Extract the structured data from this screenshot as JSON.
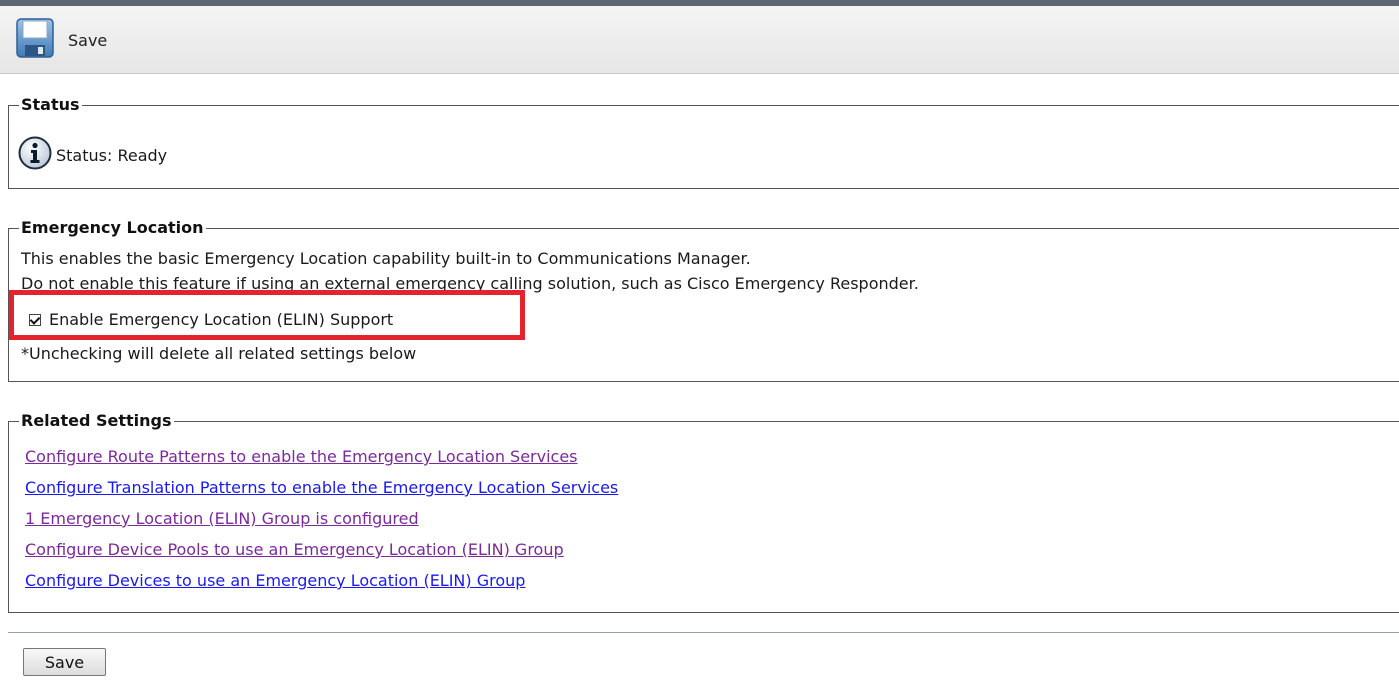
{
  "toolbar": {
    "save_label": "Save",
    "save_icon": "floppy-disk-icon"
  },
  "status": {
    "legend": "Status",
    "icon": "info-icon",
    "text": "Status: Ready"
  },
  "emergency_location": {
    "legend": "Emergency Location",
    "description_line1": "This enables the basic Emergency Location capability built-in to Communications Manager.",
    "description_line2": "Do not enable this feature if using an external emergency calling solution, such as Cisco Emergency Responder.",
    "checkbox_label": "Enable Emergency Location (ELIN) Support",
    "checkbox_checked": true,
    "note": "*Unchecking will delete all related settings below",
    "highlight_color": "#e4232e"
  },
  "related_settings": {
    "legend": "Related Settings",
    "links": [
      {
        "label": "Configure Route Patterns to enable the Emergency Location Services",
        "color": "#7a2a9a"
      },
      {
        "label": "Configure Translation Patterns to enable the Emergency Location Services",
        "color": "#1a1aee"
      },
      {
        "label": "1 Emergency Location (ELIN) Group is configured",
        "color": "#7a2a9a"
      },
      {
        "label": "Configure Device Pools to use an Emergency Location (ELIN) Group",
        "color": "#7a2a9a"
      },
      {
        "label": "Configure Devices to use an Emergency Location (ELIN) Group",
        "color": "#1a1aee"
      }
    ]
  },
  "footer": {
    "save_label": "Save"
  }
}
